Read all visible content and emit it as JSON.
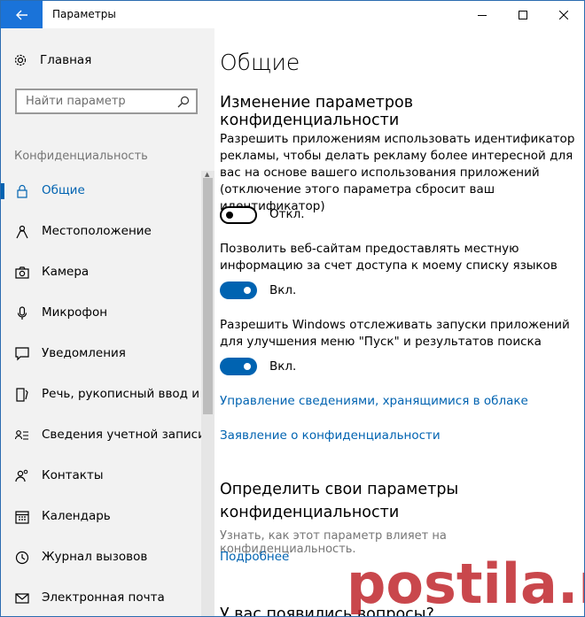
{
  "window": {
    "title": "Параметры"
  },
  "sidebar": {
    "home_label": "Главная",
    "search_placeholder": "Найти параметр",
    "section_title": "Конфиденциальность",
    "items": [
      {
        "label": "Общие",
        "icon": "lock-icon",
        "selected": true
      },
      {
        "label": "Местоположение",
        "icon": "location-person-icon"
      },
      {
        "label": "Камера",
        "icon": "camera-icon"
      },
      {
        "label": "Микрофон",
        "icon": "microphone-icon"
      },
      {
        "label": "Уведомления",
        "icon": "notification-icon"
      },
      {
        "label": "Речь, рукописный ввод и в",
        "icon": "speech-icon"
      },
      {
        "label": "Сведения учетной записи",
        "icon": "account-info-icon"
      },
      {
        "label": "Контакты",
        "icon": "contacts-icon"
      },
      {
        "label": "Календарь",
        "icon": "calendar-icon"
      },
      {
        "label": "Журнал вызовов",
        "icon": "call-history-icon"
      },
      {
        "label": "Электронная почта",
        "icon": "mail-icon"
      }
    ]
  },
  "main": {
    "page_title": "Общие",
    "section_title": "Изменение параметров конфиденциальности",
    "settings": [
      {
        "description": "Разрешить приложениям использовать идентификатор рекламы, чтобы делать рекламу более интересной для вас на основе вашего использования приложений (отключение этого параметра сбросит ваш идентификатор)",
        "state_label": "Откл.",
        "on": false
      },
      {
        "description": "Позволить веб-сайтам предоставлять местную информацию за счет доступа к моему списку языков",
        "state_label": "Вкл.",
        "on": true
      },
      {
        "description": "Разрешить Windows отслеживать запуски приложений для улучшения меню \"Пуск\" и результатов поиска",
        "state_label": "Вкл.",
        "on": true
      }
    ],
    "links": [
      "Управление сведениями, хранящимися в облаке",
      "Заявление о конфиденциальности"
    ],
    "section2_title": "Определить свои параметры конфиденциальности",
    "section2_desc": "Узнать, как этот параметр влияет на конфиденциальность.",
    "section2_link": "Подробнее",
    "section3_title": "У вас появились вопросы?"
  },
  "watermark": {
    "text": "postila.ru"
  },
  "colors": {
    "accent": "#0063b1",
    "back_button": "#1a73d9",
    "sidebar_bg": "#f2f2f2"
  }
}
